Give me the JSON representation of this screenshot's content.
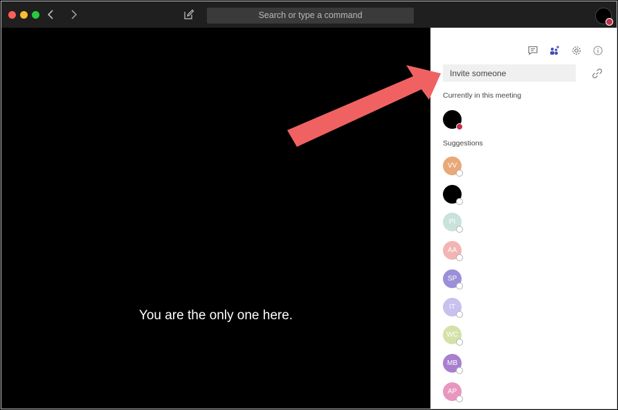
{
  "titlebar": {
    "back_icon": "chevron-left-icon",
    "forward_icon": "chevron-right-icon",
    "compose_icon": "compose-icon",
    "search_placeholder": "Search or type a command"
  },
  "stage": {
    "message": "You are the only one here."
  },
  "panel": {
    "tools": [
      "chat-icon",
      "people-add-icon",
      "gear-icon",
      "info-icon"
    ],
    "invite_placeholder": "Invite someone",
    "link_icon": "link-icon",
    "current_label": "Currently in this meeting",
    "suggestions_label": "Suggestions",
    "suggestions": [
      {
        "initials": "VV",
        "color": "#e8a878"
      },
      {
        "initials": "",
        "color": "#000000"
      },
      {
        "initials": "PI",
        "color": "#c9e3dc"
      },
      {
        "initials": "AA",
        "color": "#f3b4b4"
      },
      {
        "initials": "SP",
        "color": "#9b8fd9"
      },
      {
        "initials": "IT",
        "color": "#c9c0ef"
      },
      {
        "initials": "WC",
        "color": "#d4e2a9"
      },
      {
        "initials": "MB",
        "color": "#a97fd0"
      },
      {
        "initials": "AP",
        "color": "#e896bf"
      }
    ]
  },
  "colors": {
    "arrow": "#f06262",
    "busy": "#c4314b",
    "titlebar": "#1f1f1f"
  }
}
